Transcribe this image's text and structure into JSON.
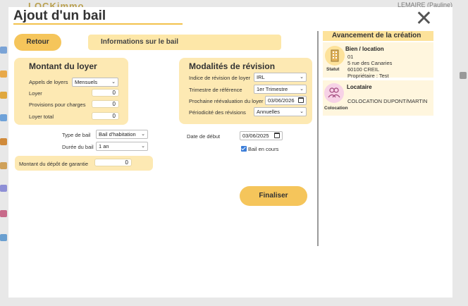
{
  "background": {
    "user_label": "LEMAIRE (Pauline)",
    "logo_text": "LOCKimmo"
  },
  "modal": {
    "title": "Ajout d'un bail",
    "close_glyph": "✕",
    "retour_label": "Retour",
    "info_bar_label": "Informations sur le bail"
  },
  "loyer": {
    "heading": "Montant du loyer",
    "appels_label": "Appels de loyers",
    "appels_value": "Mensuels",
    "loyer_label": "Loyer",
    "loyer_value": "0",
    "provisions_label": "Provisions pour charges",
    "provisions_value": "0",
    "total_label": "Loyer total",
    "total_value": "0"
  },
  "bail": {
    "type_label": "Type de bail",
    "type_value": "Bail d'habitation",
    "duree_label": "Durée du bail",
    "duree_value": "1 an",
    "depot_label": "Montant du dépôt de garantie",
    "depot_value": "0"
  },
  "revision": {
    "heading": "Modalités de révision",
    "indice_label": "Indice de révision de loyer",
    "indice_value": "IRL",
    "trimestre_label": "Trimestre de référence",
    "trimestre_value": "1er Trimestre",
    "reevaluation_label": "Prochaine réévaluation du loyer",
    "reevaluation_value": "03/06/2026",
    "periodicite_label": "Périodicité des révisions",
    "periodicite_value": "Annuelles"
  },
  "debut": {
    "label": "Date de début",
    "value": "03/06/2025",
    "en_cours_label": "Bail en cours",
    "en_cours_checked": true
  },
  "finaliser_label": "Finaliser",
  "sidebar": {
    "title": "Avancement de la création",
    "bien": {
      "name": "Bien / location",
      "status_label": "Statut",
      "line1": "01",
      "line2": "5 rue des Canaries",
      "line3": "60100 CREIL",
      "line4": "Propriétaire : Test"
    },
    "locataire": {
      "name": "Locataire",
      "status_label": "Colocation",
      "line1": "COLOCATION DUPONT/MARTIN"
    }
  },
  "colors": {
    "accent": "#f5c55b",
    "card_bg": "#fde9b3",
    "checkbox": "#3b7dd8"
  }
}
